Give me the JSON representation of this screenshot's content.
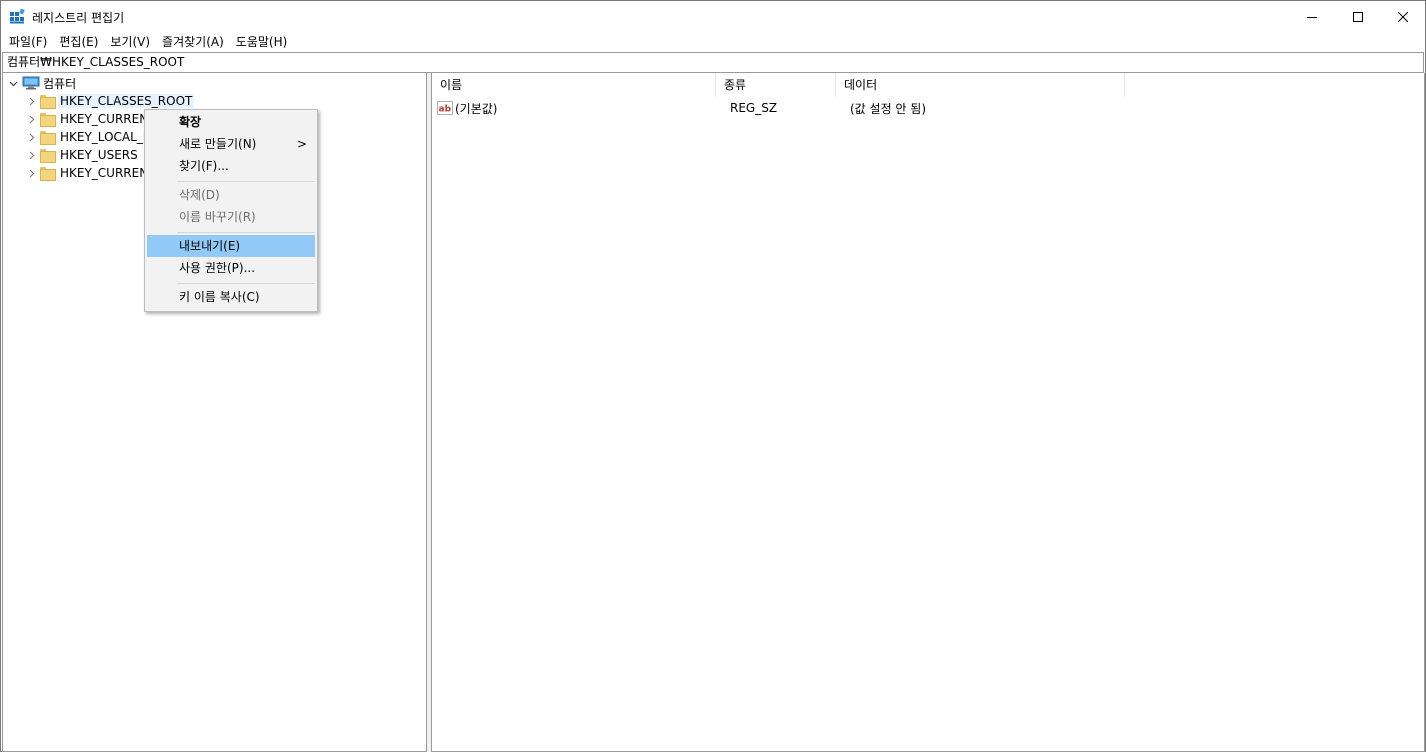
{
  "window": {
    "title": "레지스트리 편집기",
    "minimize_label": "—",
    "maximize_label": "☐",
    "close_label": "✕"
  },
  "menubar": {
    "items": [
      {
        "label": "파일(F)"
      },
      {
        "label": "편집(E)"
      },
      {
        "label": "보기(V)"
      },
      {
        "label": "즐겨찾기(A)"
      },
      {
        "label": "도움말(H)"
      }
    ]
  },
  "address": {
    "path": "컴퓨터₩HKEY_CLASSES_ROOT"
  },
  "tree": {
    "root_label": "컴퓨터",
    "items": [
      {
        "label": "HKEY_CLASSES_ROOT",
        "selected": true
      },
      {
        "label": "HKEY_CURRENT"
      },
      {
        "label": "HKEY_LOCAL_M"
      },
      {
        "label": "HKEY_USERS"
      },
      {
        "label": "HKEY_CURRENT"
      }
    ]
  },
  "list": {
    "columns": [
      "이름",
      "종류",
      "데이터"
    ],
    "rows": [
      {
        "name": "(기본값)",
        "type": "REG_SZ",
        "data": "(값 설정 안 됨)",
        "icon": "ab-string-icon"
      }
    ]
  },
  "context_menu": {
    "expand": "확장",
    "new": "새로 만들기(N)",
    "new_arrow": ">",
    "find": "찾기(F)...",
    "delete": "삭제(D)",
    "rename": "이름 바꾸기(R)",
    "export": "내보내기(E)",
    "permissions": "사용 권한(P)...",
    "copy_key_name": "키 이름 복사(C)"
  },
  "colors": {
    "selection_highlight": "#91c9f7",
    "tree_selection": "#e5f3ff",
    "folder": "#f3d57b"
  }
}
